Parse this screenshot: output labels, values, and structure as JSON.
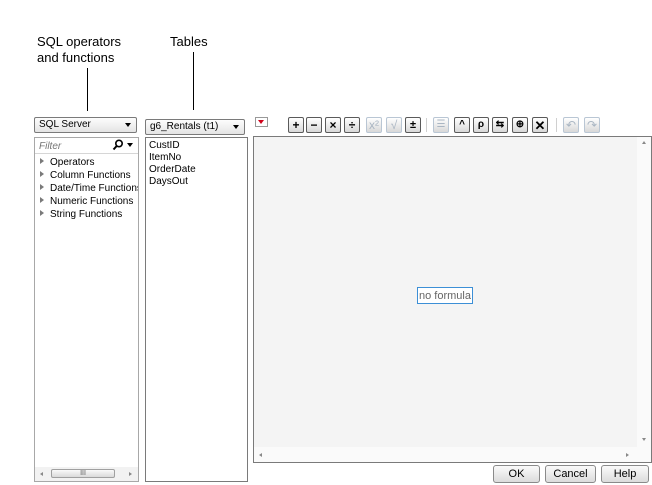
{
  "callouts": {
    "sql_operators_line1": "SQL operators",
    "sql_operators_line2": "and functions",
    "tables": "Tables"
  },
  "left_panel": {
    "dialect_value": "SQL Server",
    "filter_placeholder": "Filter",
    "tree_items": [
      "Operators",
      "Column Functions",
      "Date/Time Functions",
      "Numeric Functions",
      "String Functions"
    ],
    "hscroll_grip": "III"
  },
  "columns_panel": {
    "table_value": "g6_Rentals (t1)",
    "columns": [
      "CustID",
      "ItemNo",
      "OrderDate",
      "DaysOut"
    ]
  },
  "editor": {
    "placeholder": "no formula",
    "toolbar_icons": [
      "add-icon",
      "subtract-icon",
      "multiply-icon",
      "divide-icon",
      "power-icon",
      "root-icon",
      "plus-minus-icon",
      "list-icon",
      "caret-up-icon",
      "match-icon",
      "swap-icon",
      "local-icon",
      "clear-icon",
      "undo-icon",
      "redo-icon"
    ]
  },
  "footer": {
    "ok_label": "OK",
    "cancel_label": "Cancel",
    "help_label": "Help"
  }
}
